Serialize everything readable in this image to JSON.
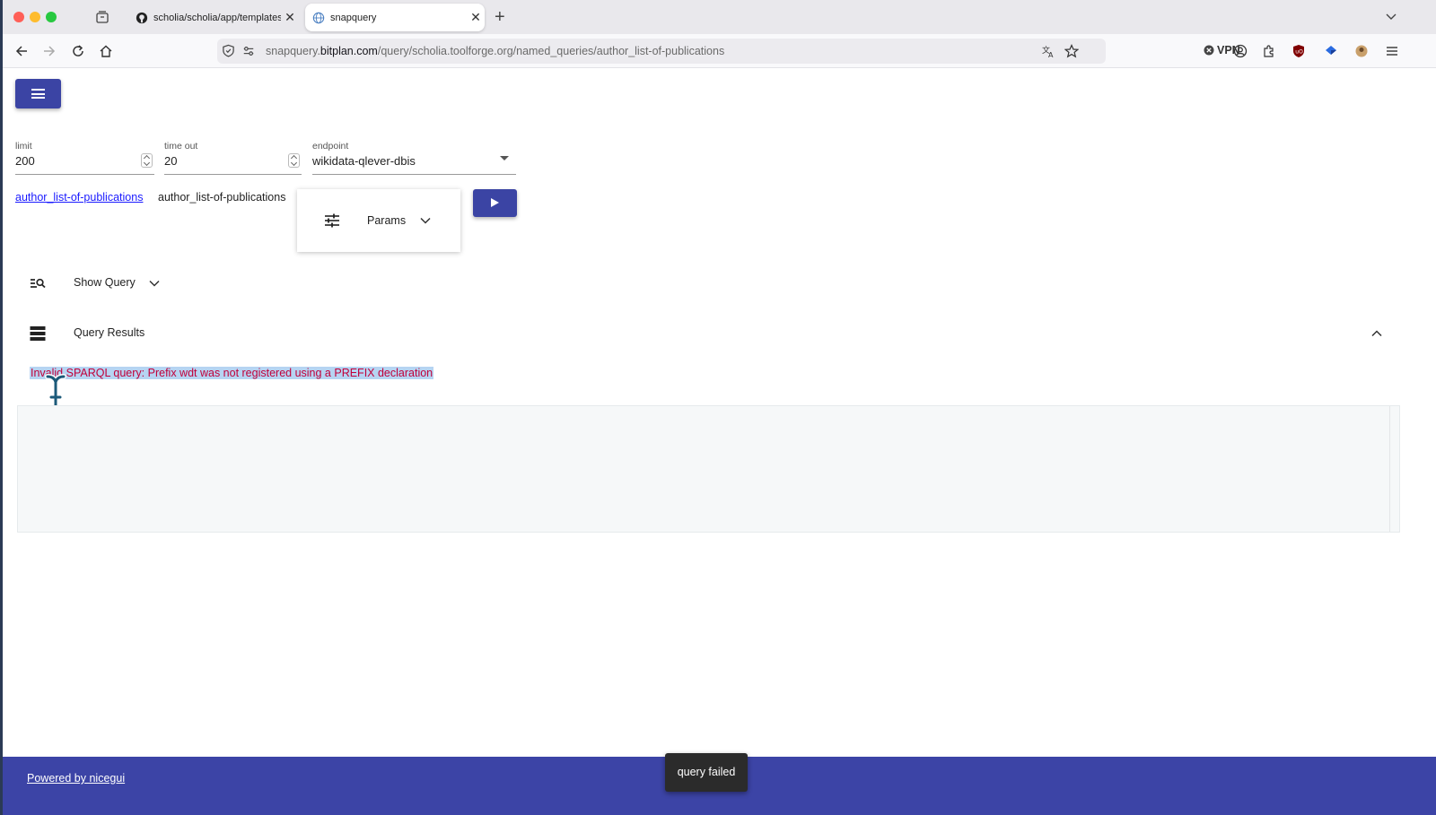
{
  "browser": {
    "tabs": [
      {
        "title": "scholia/scholia/app/templates/a",
        "active": false
      },
      {
        "title": "snapquery",
        "active": true
      }
    ],
    "url": {
      "prefix": "snapquery.",
      "domain": "bitplan.com",
      "path": "/query/scholia.toolforge.org/named_queries/author_list-of-publications"
    },
    "vpn_label": "VPN"
  },
  "form": {
    "limit": {
      "label": "limit",
      "value": "200"
    },
    "timeout": {
      "label": "time out",
      "value": "20"
    },
    "endpoint": {
      "label": "endpoint",
      "value": "wikidata-qlever-dbis"
    }
  },
  "query": {
    "link_text": "author_list-of-publications",
    "name": "author_list-of-publications",
    "params_label": "Params"
  },
  "sections": {
    "show_query": "Show Query",
    "query_results": "Query Results"
  },
  "error_message": "Invalid SPARQL query: Prefix wdt was not registered using a PREFIX declaration",
  "footer": {
    "link": "Powered by nicegui"
  },
  "notification": "query failed",
  "colors": {
    "primary": "#3b44a4",
    "error_text": "#c1003a",
    "selection": "#b6d4f2",
    "link": "#1a1aff"
  }
}
